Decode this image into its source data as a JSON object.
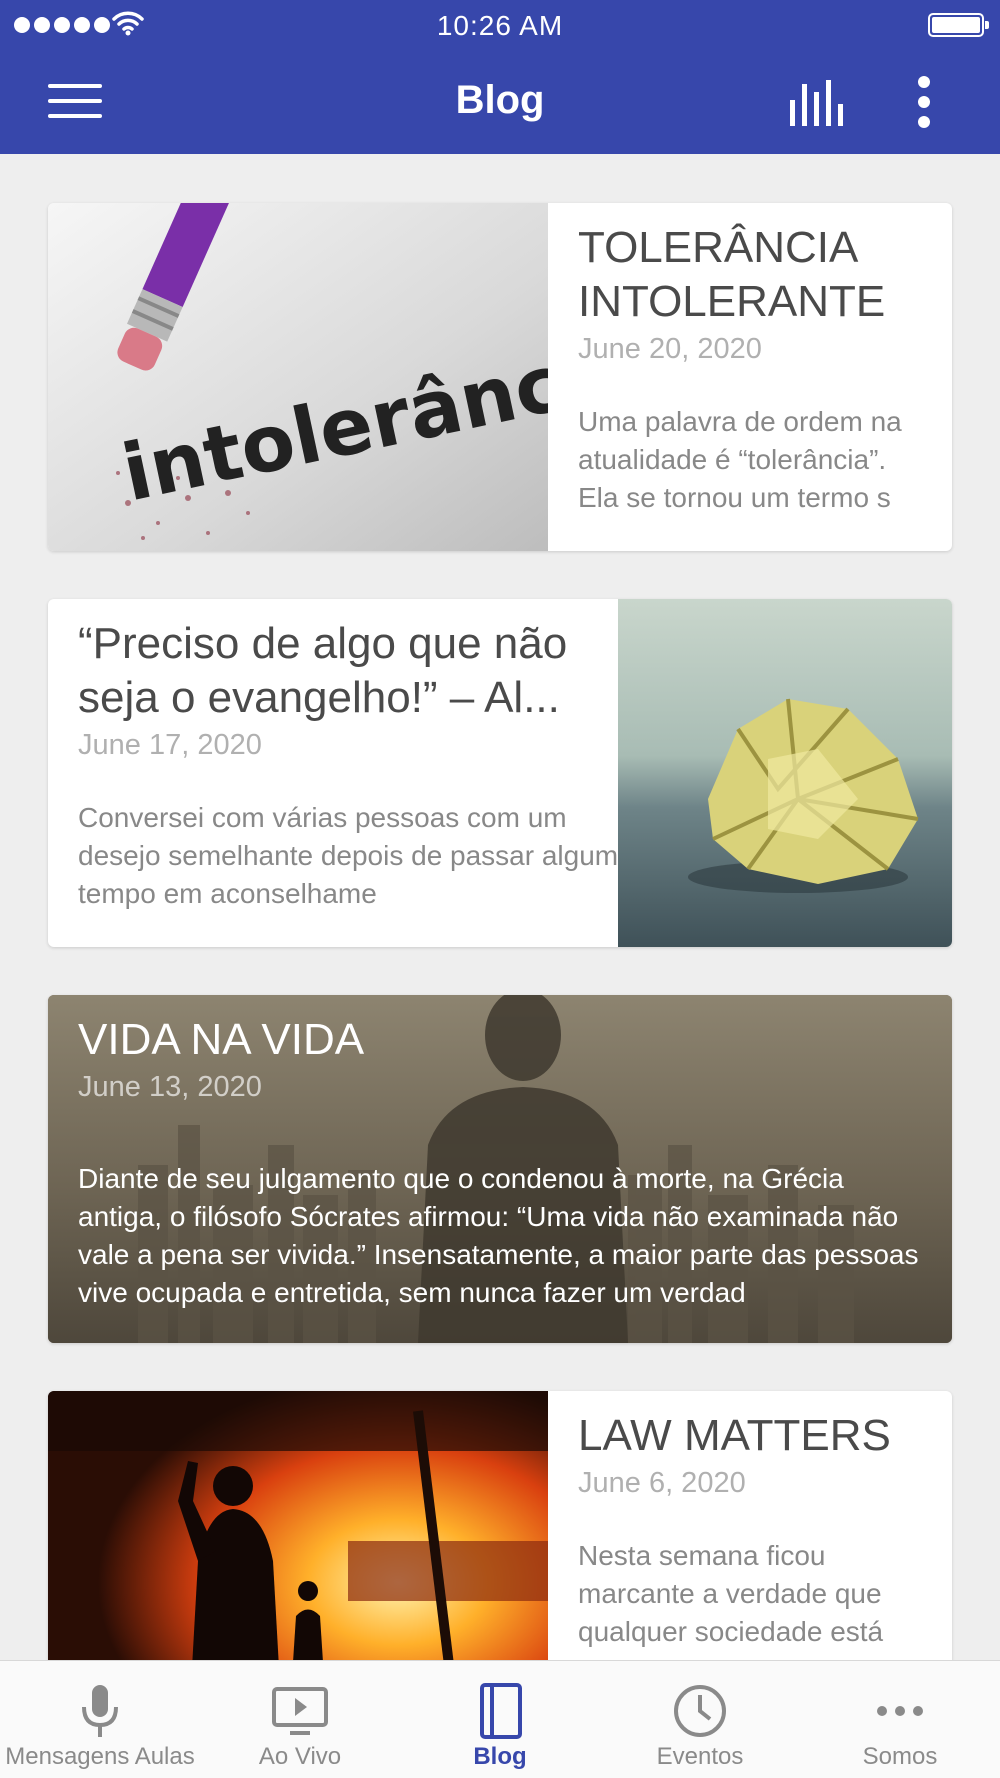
{
  "status_bar": {
    "time": "10:26 AM"
  },
  "header": {
    "title": "Blog"
  },
  "icons": {
    "menu": "hamburger-menu-icon",
    "stats": "bar-chart-icon",
    "more": "vertical-dots-icon"
  },
  "colors": {
    "primary": "#3747ab",
    "background": "#eeeeee",
    "tab_inactive": "#8a8a8a"
  },
  "posts": [
    {
      "title": "TOLERÂNCIA INTOLERANTE",
      "date": "June 20, 2020",
      "excerpt": "Uma palavra de ordem na atualidade é “tolerância”. Ela se tornou um termo s",
      "image_text": "intolerância"
    },
    {
      "title": "“Preciso de algo que não seja o evangelho!” – Al...",
      "date": "June 17, 2020",
      "excerpt": "Conversei com várias pessoas com um desejo semelhante depois de passar algum tempo em aconselhame"
    },
    {
      "title": "VIDA NA VIDA",
      "date": "June 13, 2020",
      "excerpt": "Diante de seu julgamento que o condenou à morte, na Grécia antiga, o filósofo Sócrates afirmou: “Uma vida não examinada não vale a pena ser vivida.” Insensatamente, a maior parte das pessoas vive ocupada e entretida, sem nunca fazer um verdad"
    },
    {
      "title": "LAW MATTERS",
      "date": "June 6, 2020",
      "excerpt": "Nesta semana ficou marcante a verdade que qualquer sociedade está"
    }
  ],
  "tabs": [
    {
      "label": "Mensagens Aulas",
      "icon": "microphone-icon",
      "active": false
    },
    {
      "label": "Ao Vivo",
      "icon": "play-screen-icon",
      "active": false
    },
    {
      "label": "Blog",
      "icon": "book-icon",
      "active": true
    },
    {
      "label": "Eventos",
      "icon": "clock-icon",
      "active": false
    },
    {
      "label": "Somos",
      "icon": "more-dots-icon",
      "active": false
    }
  ]
}
